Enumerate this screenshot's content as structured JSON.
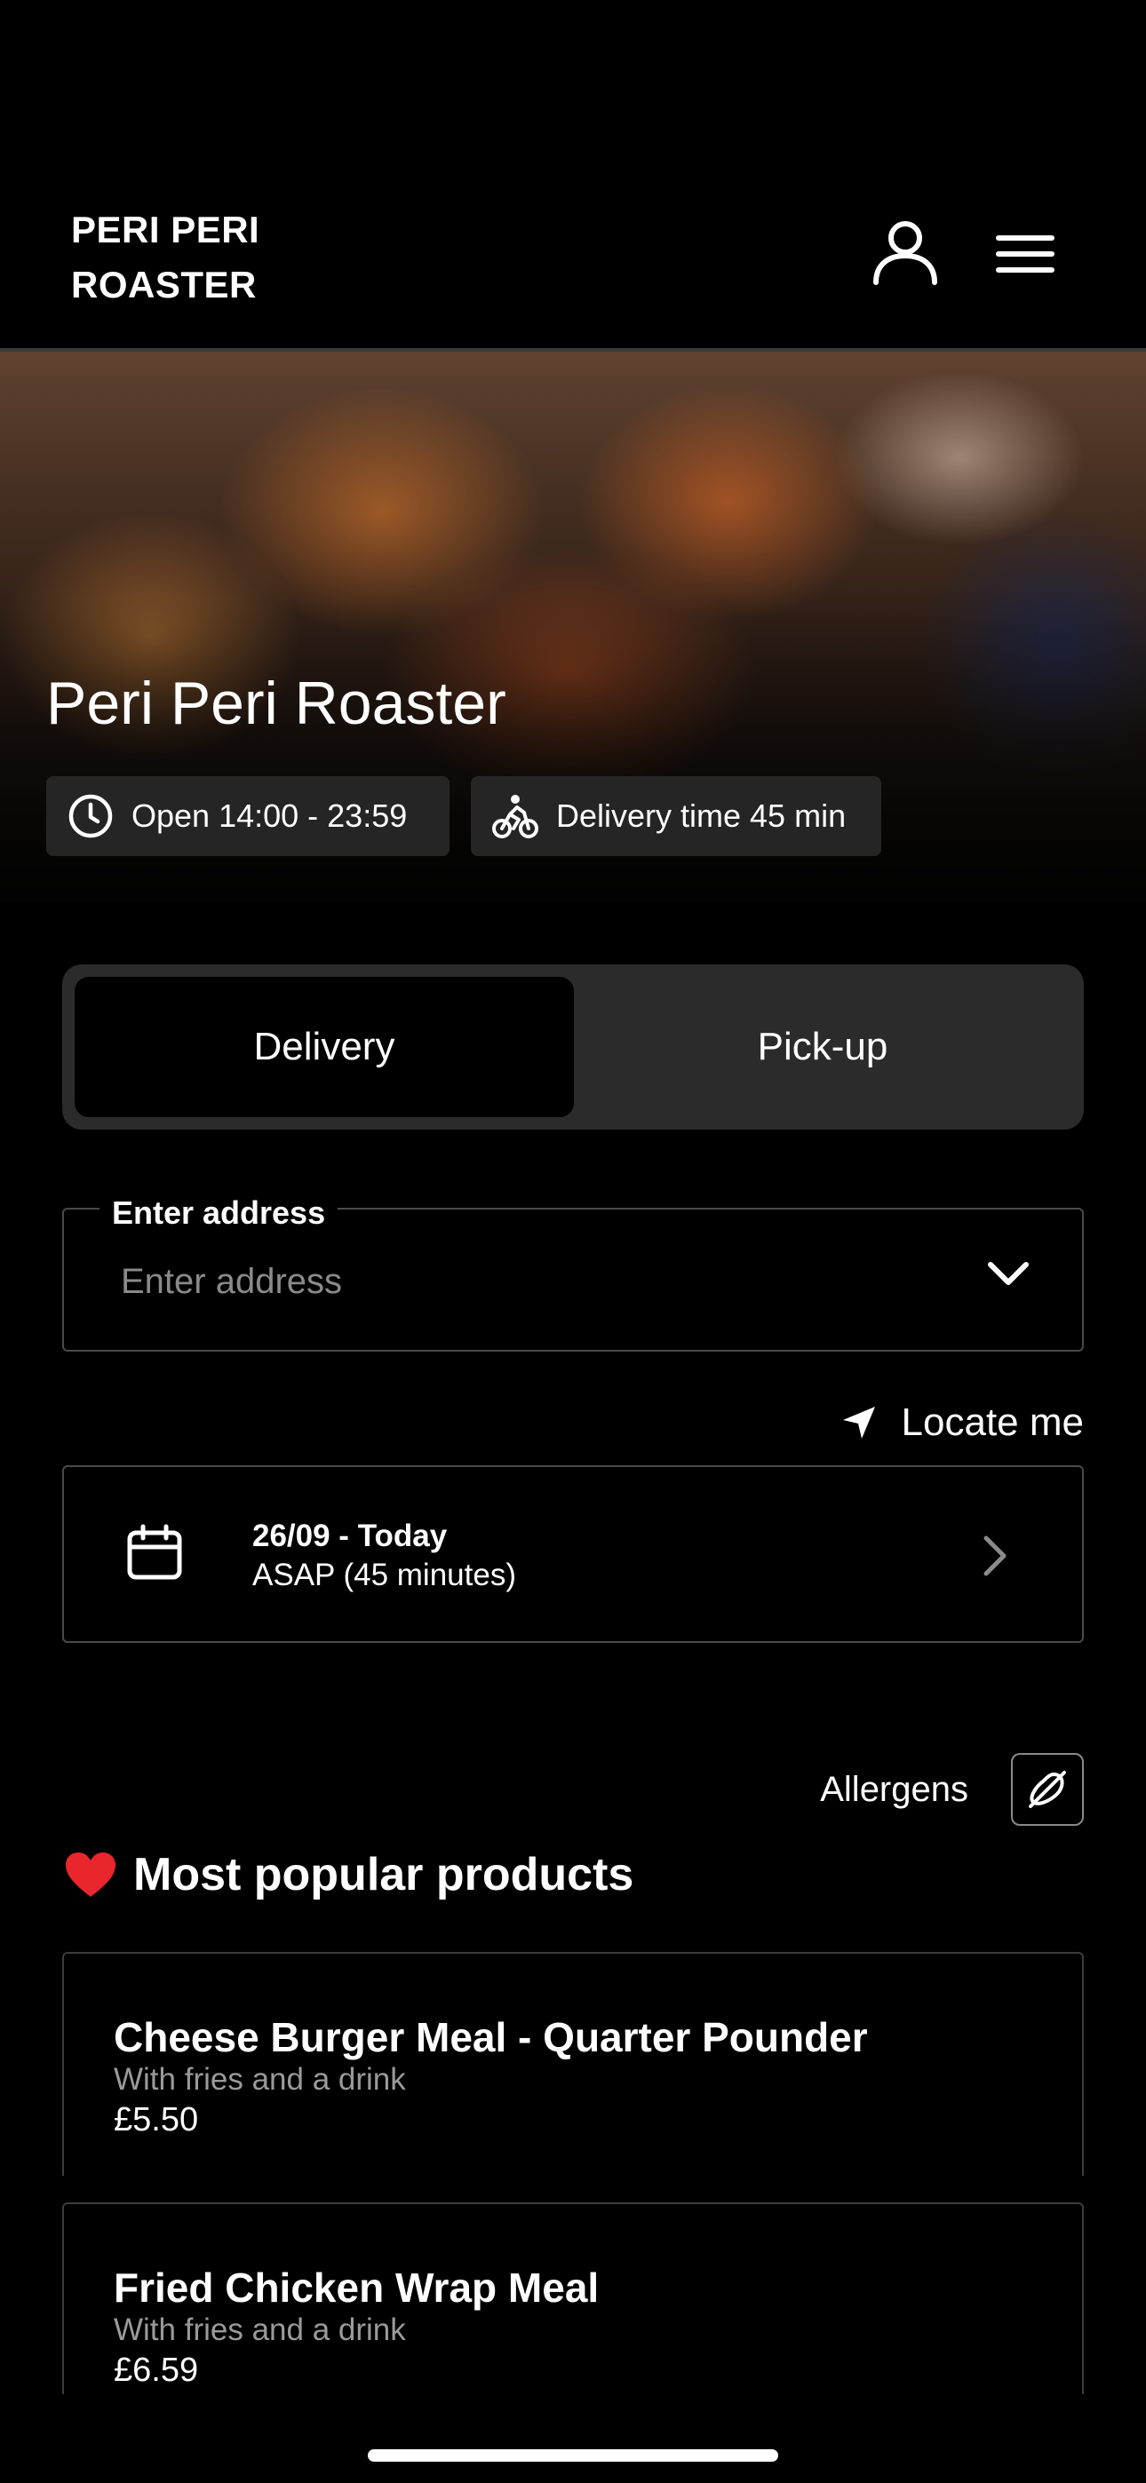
{
  "header": {
    "logo_text": "PERI PERI\nROASTER"
  },
  "hero": {
    "restaurant_name": "Peri Peri Roaster",
    "open_hours": "Open 14:00 - 23:59",
    "delivery_time": "Delivery time 45 min"
  },
  "order_mode": {
    "options": [
      "Delivery",
      "Pick-up"
    ],
    "selected": "Delivery"
  },
  "address": {
    "label": "Enter address",
    "placeholder": "Enter address",
    "value": ""
  },
  "locate": {
    "label": "Locate me"
  },
  "schedule": {
    "date": "26/09 - Today",
    "time": "ASAP (45 minutes)"
  },
  "allergens": {
    "label": "Allergens"
  },
  "popular": {
    "title": "Most popular products",
    "products": [
      {
        "name": "Cheese Burger Meal - Quarter Pounder",
        "description": "With fries and a drink",
        "price": "£5.50"
      },
      {
        "name": "Fried Chicken Wrap Meal",
        "description": "With fries and a drink",
        "price": "£6.59"
      }
    ]
  },
  "colors": {
    "background": "#000000",
    "toggle_bg": "#2b2b2b",
    "border": "#4a4a4a",
    "heart": "#e8262b",
    "muted_text": "#9a9a9a"
  }
}
